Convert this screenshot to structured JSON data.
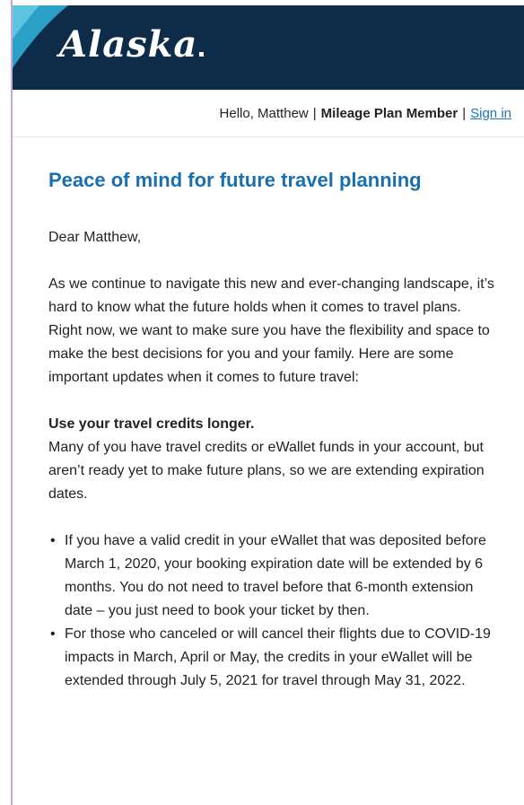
{
  "header": {
    "logo_text": "Alaska",
    "brand_color": "#0d2c4a",
    "accent_color": "#2aa0c7"
  },
  "greeting_bar": {
    "hello": "Hello, Matthew",
    "separator": "|",
    "member_status": "Mileage Plan Member",
    "sign_in": "Sign in"
  },
  "email": {
    "title": "Peace of mind for future travel planning",
    "salutation": "Dear Matthew,",
    "intro": "As we continue to navigate this new and ever-changing landscape, it’s hard to know what the future holds when it comes to travel plans. Right now, we want to make sure you have the flexibility and space to make the best decisions for you and your family. Here are some important updates when it comes to future travel:",
    "section_heading": "Use your travel credits longer.",
    "section_body": "Many of you have travel credits or eWallet funds in your account, but aren’t ready yet to make future plans, so we are extending expiration dates.",
    "bullets": [
      "If you have a valid credit in your eWallet that was deposited before March 1, 2020, your booking expiration date will be extended by 6 months. You do not need to travel before that 6-month extension date – you just need to book your ticket by then.",
      "For those who canceled or will cancel their flights due to COVID-19 impacts in March, April or May, the credits in your eWallet will be extended through July 5, 2021 for travel through May 31, 2022."
    ],
    "bullet_glyph": "•"
  }
}
